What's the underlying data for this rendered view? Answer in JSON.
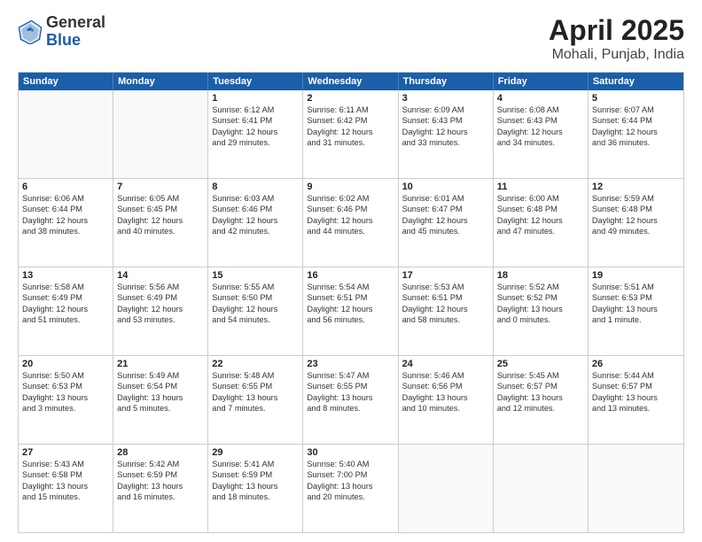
{
  "logo": {
    "general": "General",
    "blue": "Blue"
  },
  "title": {
    "month": "April 2025",
    "location": "Mohali, Punjab, India"
  },
  "header_days": [
    "Sunday",
    "Monday",
    "Tuesday",
    "Wednesday",
    "Thursday",
    "Friday",
    "Saturday"
  ],
  "rows": [
    [
      {
        "day": "",
        "lines": [],
        "empty": true
      },
      {
        "day": "",
        "lines": [],
        "empty": true
      },
      {
        "day": "1",
        "lines": [
          "Sunrise: 6:12 AM",
          "Sunset: 6:41 PM",
          "Daylight: 12 hours",
          "and 29 minutes."
        ]
      },
      {
        "day": "2",
        "lines": [
          "Sunrise: 6:11 AM",
          "Sunset: 6:42 PM",
          "Daylight: 12 hours",
          "and 31 minutes."
        ]
      },
      {
        "day": "3",
        "lines": [
          "Sunrise: 6:09 AM",
          "Sunset: 6:43 PM",
          "Daylight: 12 hours",
          "and 33 minutes."
        ]
      },
      {
        "day": "4",
        "lines": [
          "Sunrise: 6:08 AM",
          "Sunset: 6:43 PM",
          "Daylight: 12 hours",
          "and 34 minutes."
        ]
      },
      {
        "day": "5",
        "lines": [
          "Sunrise: 6:07 AM",
          "Sunset: 6:44 PM",
          "Daylight: 12 hours",
          "and 36 minutes."
        ]
      }
    ],
    [
      {
        "day": "6",
        "lines": [
          "Sunrise: 6:06 AM",
          "Sunset: 6:44 PM",
          "Daylight: 12 hours",
          "and 38 minutes."
        ]
      },
      {
        "day": "7",
        "lines": [
          "Sunrise: 6:05 AM",
          "Sunset: 6:45 PM",
          "Daylight: 12 hours",
          "and 40 minutes."
        ]
      },
      {
        "day": "8",
        "lines": [
          "Sunrise: 6:03 AM",
          "Sunset: 6:46 PM",
          "Daylight: 12 hours",
          "and 42 minutes."
        ]
      },
      {
        "day": "9",
        "lines": [
          "Sunrise: 6:02 AM",
          "Sunset: 6:46 PM",
          "Daylight: 12 hours",
          "and 44 minutes."
        ]
      },
      {
        "day": "10",
        "lines": [
          "Sunrise: 6:01 AM",
          "Sunset: 6:47 PM",
          "Daylight: 12 hours",
          "and 45 minutes."
        ]
      },
      {
        "day": "11",
        "lines": [
          "Sunrise: 6:00 AM",
          "Sunset: 6:48 PM",
          "Daylight: 12 hours",
          "and 47 minutes."
        ]
      },
      {
        "day": "12",
        "lines": [
          "Sunrise: 5:59 AM",
          "Sunset: 6:48 PM",
          "Daylight: 12 hours",
          "and 49 minutes."
        ]
      }
    ],
    [
      {
        "day": "13",
        "lines": [
          "Sunrise: 5:58 AM",
          "Sunset: 6:49 PM",
          "Daylight: 12 hours",
          "and 51 minutes."
        ]
      },
      {
        "day": "14",
        "lines": [
          "Sunrise: 5:56 AM",
          "Sunset: 6:49 PM",
          "Daylight: 12 hours",
          "and 53 minutes."
        ]
      },
      {
        "day": "15",
        "lines": [
          "Sunrise: 5:55 AM",
          "Sunset: 6:50 PM",
          "Daylight: 12 hours",
          "and 54 minutes."
        ]
      },
      {
        "day": "16",
        "lines": [
          "Sunrise: 5:54 AM",
          "Sunset: 6:51 PM",
          "Daylight: 12 hours",
          "and 56 minutes."
        ]
      },
      {
        "day": "17",
        "lines": [
          "Sunrise: 5:53 AM",
          "Sunset: 6:51 PM",
          "Daylight: 12 hours",
          "and 58 minutes."
        ]
      },
      {
        "day": "18",
        "lines": [
          "Sunrise: 5:52 AM",
          "Sunset: 6:52 PM",
          "Daylight: 13 hours",
          "and 0 minutes."
        ]
      },
      {
        "day": "19",
        "lines": [
          "Sunrise: 5:51 AM",
          "Sunset: 6:53 PM",
          "Daylight: 13 hours",
          "and 1 minute."
        ]
      }
    ],
    [
      {
        "day": "20",
        "lines": [
          "Sunrise: 5:50 AM",
          "Sunset: 6:53 PM",
          "Daylight: 13 hours",
          "and 3 minutes."
        ]
      },
      {
        "day": "21",
        "lines": [
          "Sunrise: 5:49 AM",
          "Sunset: 6:54 PM",
          "Daylight: 13 hours",
          "and 5 minutes."
        ]
      },
      {
        "day": "22",
        "lines": [
          "Sunrise: 5:48 AM",
          "Sunset: 6:55 PM",
          "Daylight: 13 hours",
          "and 7 minutes."
        ]
      },
      {
        "day": "23",
        "lines": [
          "Sunrise: 5:47 AM",
          "Sunset: 6:55 PM",
          "Daylight: 13 hours",
          "and 8 minutes."
        ]
      },
      {
        "day": "24",
        "lines": [
          "Sunrise: 5:46 AM",
          "Sunset: 6:56 PM",
          "Daylight: 13 hours",
          "and 10 minutes."
        ]
      },
      {
        "day": "25",
        "lines": [
          "Sunrise: 5:45 AM",
          "Sunset: 6:57 PM",
          "Daylight: 13 hours",
          "and 12 minutes."
        ]
      },
      {
        "day": "26",
        "lines": [
          "Sunrise: 5:44 AM",
          "Sunset: 6:57 PM",
          "Daylight: 13 hours",
          "and 13 minutes."
        ]
      }
    ],
    [
      {
        "day": "27",
        "lines": [
          "Sunrise: 5:43 AM",
          "Sunset: 6:58 PM",
          "Daylight: 13 hours",
          "and 15 minutes."
        ]
      },
      {
        "day": "28",
        "lines": [
          "Sunrise: 5:42 AM",
          "Sunset: 6:59 PM",
          "Daylight: 13 hours",
          "and 16 minutes."
        ]
      },
      {
        "day": "29",
        "lines": [
          "Sunrise: 5:41 AM",
          "Sunset: 6:59 PM",
          "Daylight: 13 hours",
          "and 18 minutes."
        ]
      },
      {
        "day": "30",
        "lines": [
          "Sunrise: 5:40 AM",
          "Sunset: 7:00 PM",
          "Daylight: 13 hours",
          "and 20 minutes."
        ]
      },
      {
        "day": "",
        "lines": [],
        "empty": true
      },
      {
        "day": "",
        "lines": [],
        "empty": true
      },
      {
        "day": "",
        "lines": [],
        "empty": true
      }
    ]
  ]
}
